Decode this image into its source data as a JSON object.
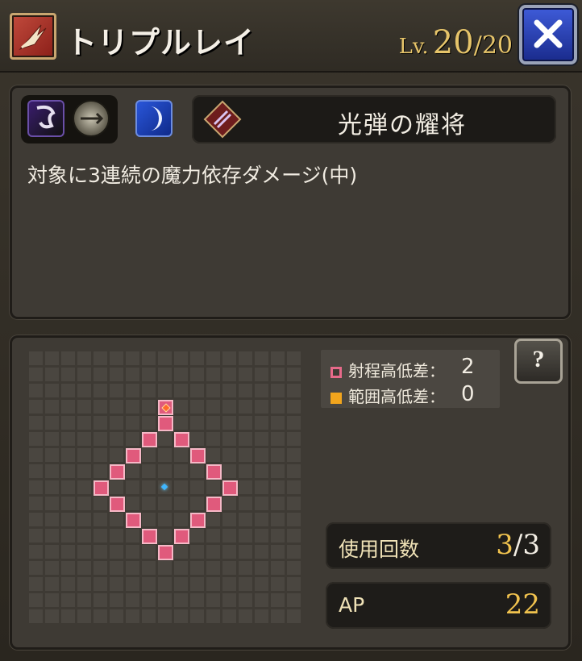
{
  "header": {
    "skill_name": "トリプルレイ",
    "level_prefix": "Lv.",
    "level_current": "20",
    "level_separator": "/",
    "level_max": "20"
  },
  "skill_panel": {
    "badges": [
      "purple-slash-icon",
      "arrow-disc-icon",
      "crescent-moon-icon"
    ],
    "title": "光弾の耀将",
    "description": "対象に3連続の魔力依存ダメージ(中)"
  },
  "range_panel": {
    "legend": {
      "height_range_label": "射程高低差：",
      "height_range_value": "2",
      "height_area_label": "範囲高低差：",
      "height_area_value": "0"
    },
    "help_label": "?",
    "uses": {
      "label": "使用回数",
      "current": "3",
      "separator": "/",
      "max": "3"
    },
    "ap": {
      "label": "AP",
      "value": "22"
    }
  },
  "colors": {
    "range_cell": "#e05a7c",
    "target_marker": "#ff6a2a",
    "center_marker": "#3fb6ff",
    "gold_text": "#e6c46a"
  }
}
